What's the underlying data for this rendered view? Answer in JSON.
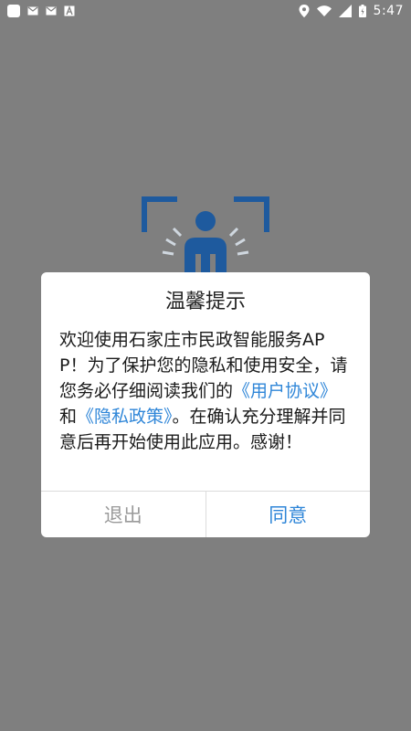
{
  "status_bar": {
    "left_icons": [
      "app-square-icon",
      "mail-icon",
      "mail-icon",
      "font-icon"
    ],
    "right_icons": [
      "location-icon",
      "wifi-icon",
      "signal-icon",
      "battery-icon"
    ],
    "time": "5:47"
  },
  "splash": {
    "logo_icon": "civil-affairs-logo-icon",
    "logo_color": "#1e5a9e"
  },
  "dialog": {
    "title": "温馨提示",
    "body": {
      "text_1": "欢迎使用石家庄市民政智能服务APP！为了保护您的隐私和使用安全，请您务必仔细阅读我们的",
      "link_user_agreement": "《用户协议》",
      "text_and": "和",
      "link_privacy_policy": "《隐私政策》",
      "text_2": "。在确认充分理解并同意后再开始使用此应用。感谢！"
    },
    "cancel_label": "退出",
    "agree_label": "同意",
    "link_color": "#2f86d8"
  }
}
